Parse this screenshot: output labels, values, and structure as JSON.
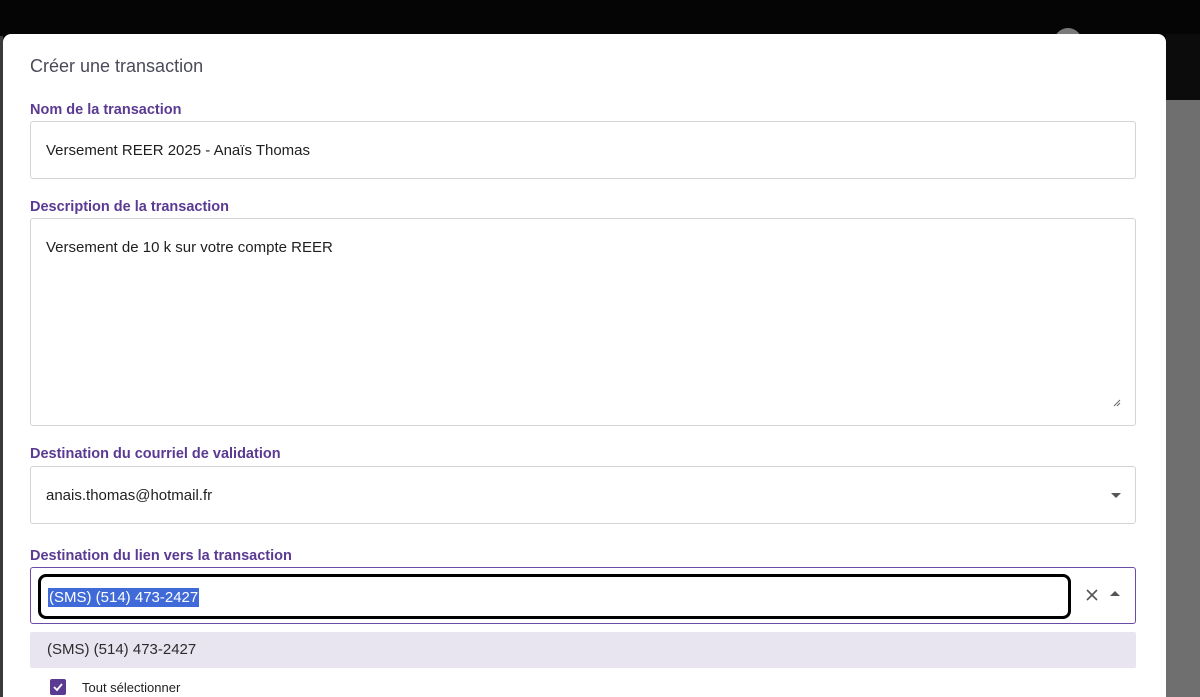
{
  "dialog": {
    "title": "Créer une transaction"
  },
  "fields": {
    "name": {
      "label": "Nom de la transaction",
      "value": "Versement REER 2025 - Anaïs Thomas"
    },
    "description": {
      "label": "Description de la transaction",
      "value": "Versement de 10 k sur votre compte REER"
    },
    "validation_email": {
      "label": "Destination du courriel de validation",
      "value": "anais.thomas@hotmail.fr"
    },
    "link_destination": {
      "label": "Destination du lien vers la transaction",
      "value": "(SMS) (514) 473-2427"
    }
  },
  "dropdown": {
    "options": [
      "(SMS) (514) 473-2427"
    ]
  },
  "select_all": {
    "label": "Tout sélectionner",
    "checked": true
  },
  "colors": {
    "accent": "#5b3a92",
    "selection": "#3f6ad8",
    "option_highlight": "#e9e5f0"
  }
}
